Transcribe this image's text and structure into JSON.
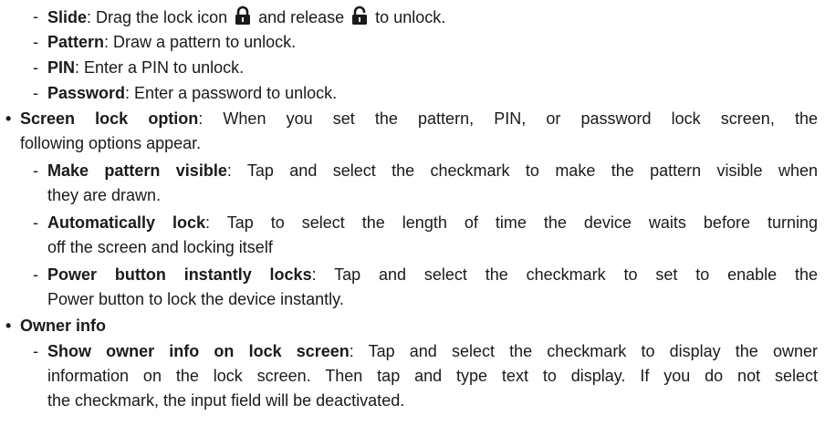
{
  "lock_types": [
    {
      "term": "Slide",
      "before_icon1": ": Drag the lock icon ",
      "between_icons": " and release ",
      "after_icon2": " to unlock."
    },
    {
      "term": "Pattern",
      "desc": ": Draw a pattern to unlock."
    },
    {
      "term": "PIN",
      "desc": ": Enter a PIN to unlock."
    },
    {
      "term": "Password",
      "desc": ": Enter a password to unlock."
    }
  ],
  "screen_lock_option": {
    "term": "Screen lock option",
    "desc_line1": ": When you set the pattern, PIN, or password lock screen, the",
    "desc_line2": "following options appear.",
    "items": [
      {
        "term": "Make pattern visible",
        "line1": ": Tap and select the checkmark to make the pattern visible when",
        "line2": "they are drawn."
      },
      {
        "term": "Automatically lock",
        "line1": ": Tap to select the length of time the device waits before turning",
        "line2": "off the screen and locking itself"
      },
      {
        "term": "Power button instantly locks",
        "line1": ": Tap and select the checkmark to set to enable the",
        "line2": "Power button to lock the device instantly."
      }
    ]
  },
  "owner_info": {
    "term": "Owner info",
    "items": [
      {
        "term": "Show owner info on lock screen",
        "line1": ": Tap and select the checkmark to display the owner",
        "line2": "information on the lock screen. Then tap and type text to display. If you do not select",
        "line3": "the checkmark, the input field will be deactivated."
      }
    ]
  },
  "glyphs": {
    "dash": "-",
    "bullet": "•"
  },
  "icons": {
    "locked": "lock-closed-icon",
    "unlocked": "lock-open-icon"
  }
}
